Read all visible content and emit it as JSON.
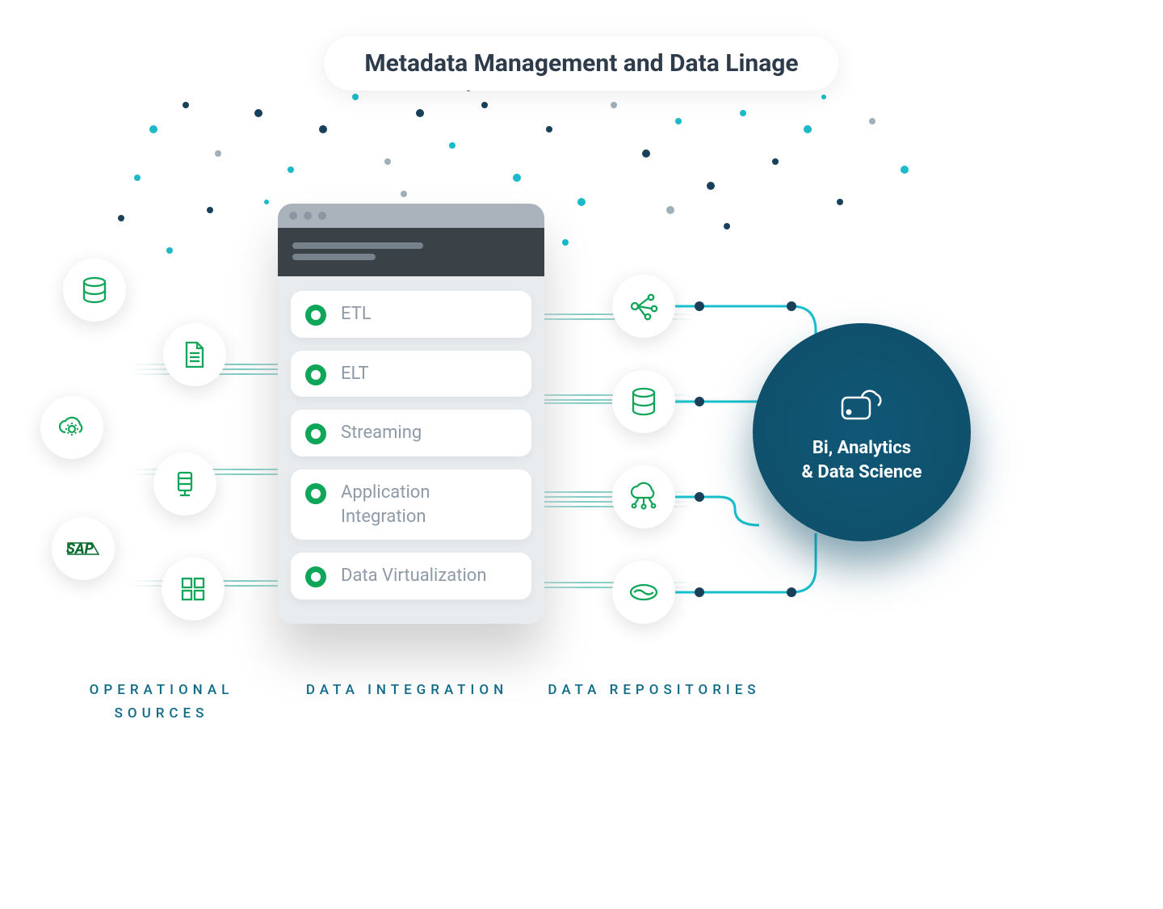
{
  "title": "Metadata Management and Data Linage",
  "integration": {
    "items": [
      "ETL",
      "ELT",
      "Streaming",
      "Application Integration",
      "Data Virtualization"
    ]
  },
  "bi": {
    "line1": "Bi, Analytics",
    "line2": "& Data Science"
  },
  "columns": {
    "ops": "OPERATIONAL SOURCES",
    "int": "DATA INTEGRATION",
    "repo": "DATA REPOSITORIES"
  },
  "sapLabel": "SAP",
  "colors": {
    "title": "#2d3b4a",
    "accentGreen": "#10a65a",
    "biBg": "#0e4e68",
    "teal": "#18bfcf",
    "navy": "#18405a",
    "columnLabel": "#0f6a88"
  }
}
